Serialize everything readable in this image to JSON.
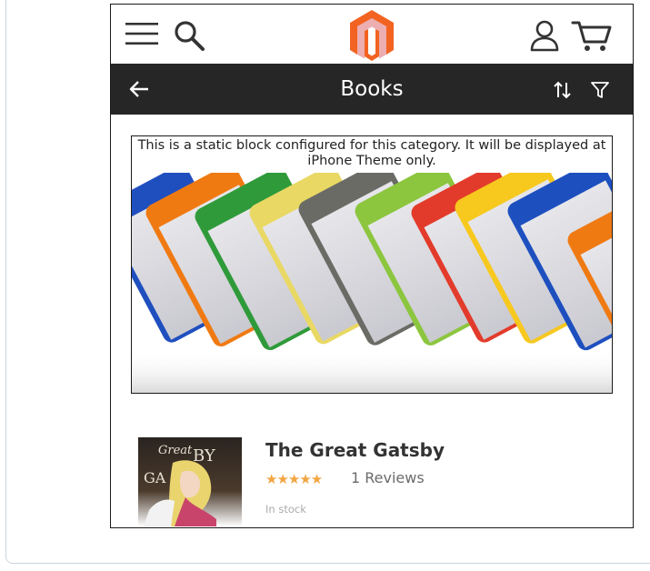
{
  "header": {
    "logo_icon": "magento-logo-icon",
    "menu_icon": "hamburger-menu-icon",
    "search_icon": "search-icon",
    "account_icon": "user-account-icon",
    "cart_icon": "shopping-cart-icon"
  },
  "category_bar": {
    "back_icon": "arrow-left-icon",
    "title": "Books",
    "sort_icon": "sort-arrows-icon",
    "filter_icon": "filter-funnel-icon"
  },
  "static_block": {
    "text": "This is a static block configured for this category. It will be displayed at iPhone Theme only.",
    "image": "colorful-books-banner-image"
  },
  "product": {
    "name": "The Great Gatsby",
    "stars": "★★★★★",
    "rating": 5,
    "reviews": "1 Reviews",
    "stock": "In stock",
    "thumbnail": "great-gatsby-cover-image"
  },
  "colors": {
    "category_bar_bg": "#262626",
    "logo_orange": "#f26322",
    "star_color": "#f2a541"
  }
}
